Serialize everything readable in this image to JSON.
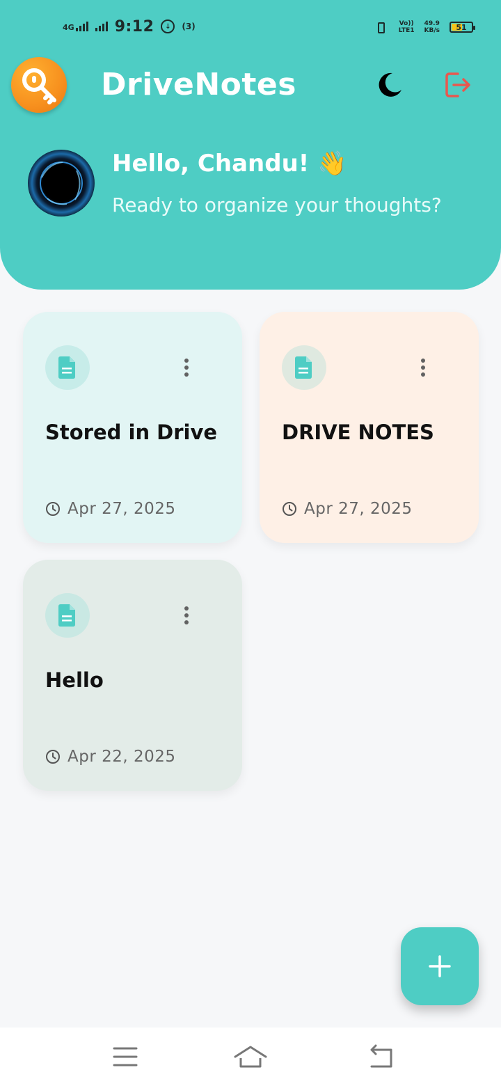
{
  "status_bar": {
    "network": "4G",
    "time": "9:12",
    "data_saver": "↓",
    "hotspot": "(3)",
    "volte_top": "Vo))",
    "volte_bottom": "LTE1",
    "speed_value": "49.9",
    "speed_unit": "KB/s",
    "battery_level": "51"
  },
  "app_bar": {
    "title": "DriveNotes",
    "logo_icon": "key-icon",
    "theme_icon": "moon-icon",
    "logout_icon": "logout-icon"
  },
  "greeting": {
    "title": "Hello, Chandu! 👋",
    "subtitle": "Ready to organize your thoughts?"
  },
  "notes": [
    {
      "title": "Stored in Drive",
      "date": "Apr 27, 2025",
      "bg": "#e2f5f4"
    },
    {
      "title": "DRIVE NOTES",
      "date": "Apr 27, 2025",
      "bg": "#fef0e6"
    },
    {
      "title": "Hello",
      "date": "Apr 22, 2025",
      "bg": "#e3ece8"
    }
  ],
  "fab": {
    "icon": "plus-icon"
  },
  "colors": {
    "primary": "#4ecdc4",
    "logo_orange": "#f7901e",
    "logout_red": "#e8584f"
  }
}
